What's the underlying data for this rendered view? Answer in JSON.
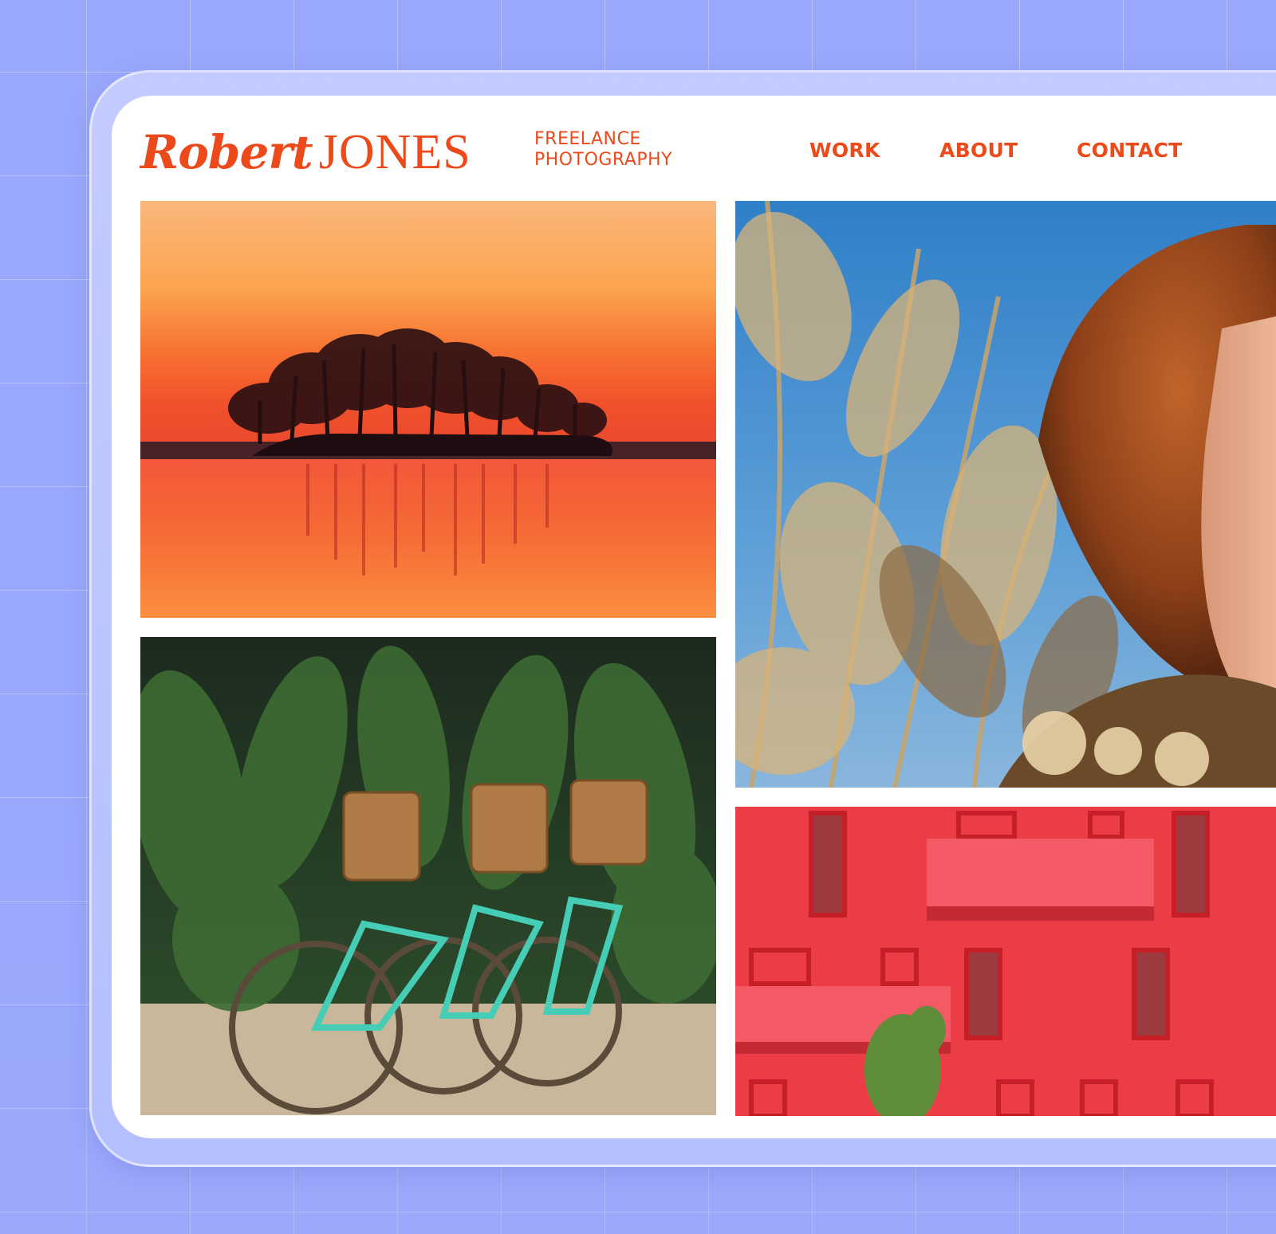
{
  "site": {
    "logo_first": "Robert",
    "logo_last": "JONES",
    "tagline_line1": "FREELANCE",
    "tagline_line2": "PHOTOGRAPHY"
  },
  "nav": {
    "work": "WORK",
    "about": "ABOUT",
    "contact": "CONTACT"
  },
  "colors": {
    "accent": "#ec4a1b",
    "background": "#9aa8fb",
    "screen": "#ffffff"
  },
  "gallery": [
    {
      "subject": "sunset-island",
      "icon": "sunset-lake-photo"
    },
    {
      "subject": "portrait",
      "icon": "portrait-photo"
    },
    {
      "subject": "bicycles",
      "icon": "bicycles-photo"
    },
    {
      "subject": "red-building",
      "icon": "red-building-photo"
    }
  ]
}
